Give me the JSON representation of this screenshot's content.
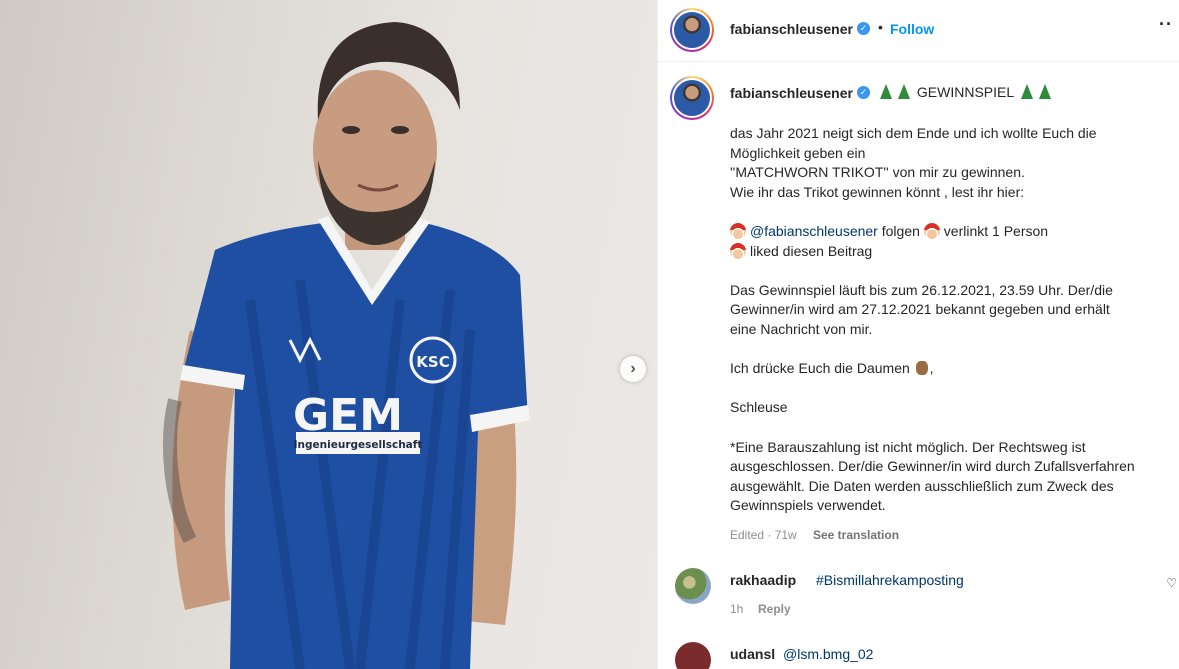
{
  "post": {
    "username": "fabianschleusener",
    "follow_label": "Follow",
    "header_separator": "•",
    "more_label": "··",
    "verified_icon": "verified-badge-icon",
    "next_icon": "chevron-right-icon",
    "next_glyph": "›"
  },
  "photo": {
    "jersey_sponsor": "GEM",
    "jersey_sponsor_sub": "Ingenieurgesellschaft",
    "jersey_crest": "KSC",
    "colors": {
      "jersey": "#1f4fa3",
      "background": "#e3e0dc"
    }
  },
  "caption": {
    "username": "fabianschleusener",
    "title": "GEWINNSPIEL",
    "lines": [
      "das Jahr 2021 neigt sich dem Ende und ich wollte Euch die",
      "Möglichkeit geben ein",
      "''MATCHWORN TRIKOT'' von mir zu gewinnen.",
      "Wie ihr das Trikot gewinnen könnt , lest ihr hier:"
    ],
    "step_mention": "@fabianschleusener",
    "step_follow": "folgen",
    "step_tag": "verlinkt 1 Person",
    "step_like": "liked diesen Beitrag",
    "schedule": [
      "Das Gewinnspiel läuft bis zum 26.12.2021, 23.59 Uhr. Der/die",
      "Gewinner/in wird am 27.12.2021 bekannt gegeben und erhält",
      "eine Nachricht von mir."
    ],
    "thumbs_pre": "Ich drücke Euch die Daumen",
    "thumbs_post": ",",
    "signoff": "Schleuse",
    "disclaimer": [
      "*Eine Barauszahlung ist nicht möglich. Der Rechtsweg ist",
      "ausgeschlossen. Der/die Gewinner/in wird durch Zufallsverfahren",
      "ausgewählt. Die Daten werden ausschließlich zum Zweck des",
      "Gewinnspiels verwendet."
    ],
    "meta": "Edited · 71w",
    "see_translation": "See translation"
  },
  "comments": [
    {
      "username": "rakhaadip",
      "text": "#Bismillahrekamposting",
      "time": "1h",
      "reply_label": "Reply",
      "like_icon": "heart-icon"
    },
    {
      "username": "udansl",
      "text": "@lsm.bmg_02"
    }
  ]
}
